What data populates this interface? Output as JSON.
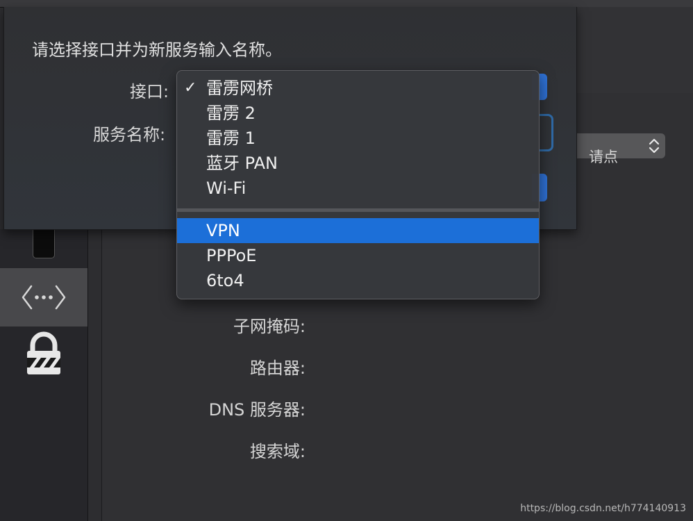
{
  "sheet": {
    "title": "请选择接口并为新服务输入名称。",
    "interface_label": "接口:",
    "service_name_label": "服务名称:"
  },
  "menu": {
    "items": [
      {
        "label": "雷雳网桥",
        "checked": true
      },
      {
        "label": "雷雳 2"
      },
      {
        "label": "雷雳 1"
      },
      {
        "label": "蓝牙 PAN"
      },
      {
        "label": "Wi-Fi"
      },
      {
        "label": "VPN",
        "highlighted": true
      },
      {
        "label": "PPPoE"
      },
      {
        "label": "6to4"
      }
    ],
    "checkmark": "✓"
  },
  "background": {
    "hint_text": "请点",
    "fields": {
      "subnet_mask": "子网掩码:",
      "router": "路由器:",
      "dns": "DNS 服务器:",
      "search_domains": "搜索域:"
    }
  },
  "watermark": "https://blog.csdn.net/h774140913",
  "colors": {
    "accent": "#1c6fd8",
    "menu_bg": "#36383c",
    "sidebar_selected": "#48484b"
  }
}
